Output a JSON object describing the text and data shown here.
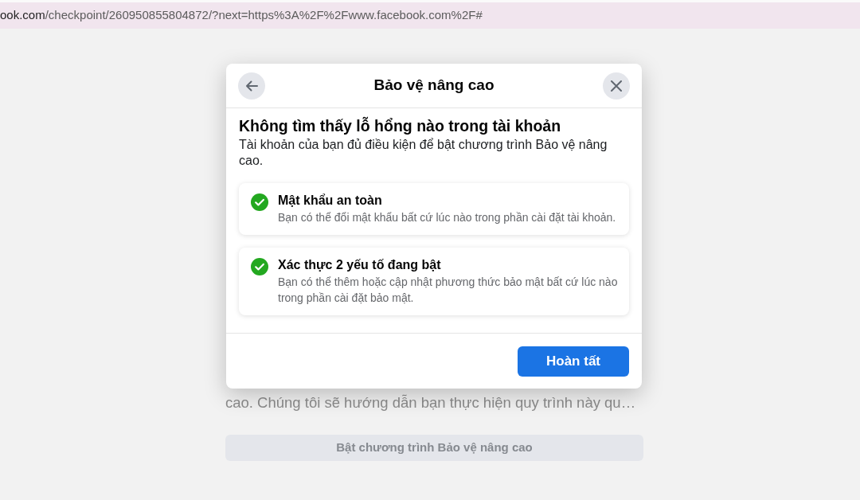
{
  "address_bar": {
    "url_host": "ook.com",
    "url_rest": "/checkpoint/260950855804872/?next=https%3A%2F%2Fwww.facebook.com%2F#"
  },
  "background_page": {
    "text": "cao. Chúng tôi sẽ hướng dẫn bạn thực hiện quy trình này qu…",
    "button": "Bật chương trình Bảo vệ nâng cao"
  },
  "dialog": {
    "title": "Bảo vệ nâng cao",
    "heading": "Không tìm thấy lỗ hổng nào trong tài khoản",
    "description": "Tài khoản của bạn đủ điều kiện để bật chương trình Bảo vệ nâng cao.",
    "checks": [
      {
        "title": "Mật khẩu an toàn",
        "description": "Bạn có thể đổi mật khẩu bất cứ lúc nào trong phần cài đặt tài khoản.",
        "checked": true
      },
      {
        "title": "Xác thực 2 yếu tố đang bật",
        "description": "Bạn có thể thêm hoặc cập nhật phương thức bảo mật bất cứ lúc nào trong phần cài đặt bảo mật.",
        "checked": true
      }
    ],
    "done_button": "Hoàn tất"
  }
}
